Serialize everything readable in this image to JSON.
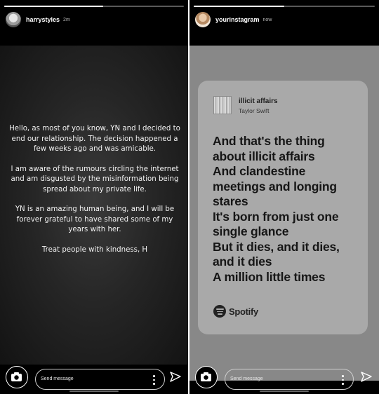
{
  "left_story": {
    "progress": 0.55,
    "username": "harrystyles",
    "timestamp": "2m",
    "statement": [
      "Hello, as most of you know, YN and I decided to end our relationship. The decision happened a few weeks ago and was amicable.",
      "I am aware of the rumours circling the internet and am disgusted by the misinformation being spread about my private life.",
      "YN is an amazing human being, and I will be forever grateful to have shared some of my years with her.",
      "Treat people with kindness, H"
    ],
    "message_placeholder": "Send message"
  },
  "right_story": {
    "progress": 0.5,
    "username": "yourinstagram",
    "timestamp": "now",
    "track": {
      "title": "illicit affairs",
      "artist": "Taylor Swift"
    },
    "lyrics": [
      "And that's the thing",
      "about illicit affairs",
      "And clandestine",
      "meetings and longing",
      "stares",
      "It's born from just one",
      "single glance",
      "But it dies, and it dies,",
      "and it dies",
      "A million little times"
    ],
    "spotify_label": "Spotify",
    "message_placeholder": "Send message"
  },
  "icons": {
    "camera": "camera-icon",
    "more": "more-vertical-icon",
    "send": "send-icon",
    "spotify": "spotify-logo-icon"
  },
  "colors": {
    "story_background": "#000000",
    "card_background": "#a9a9a9",
    "right_background": "#888888"
  }
}
